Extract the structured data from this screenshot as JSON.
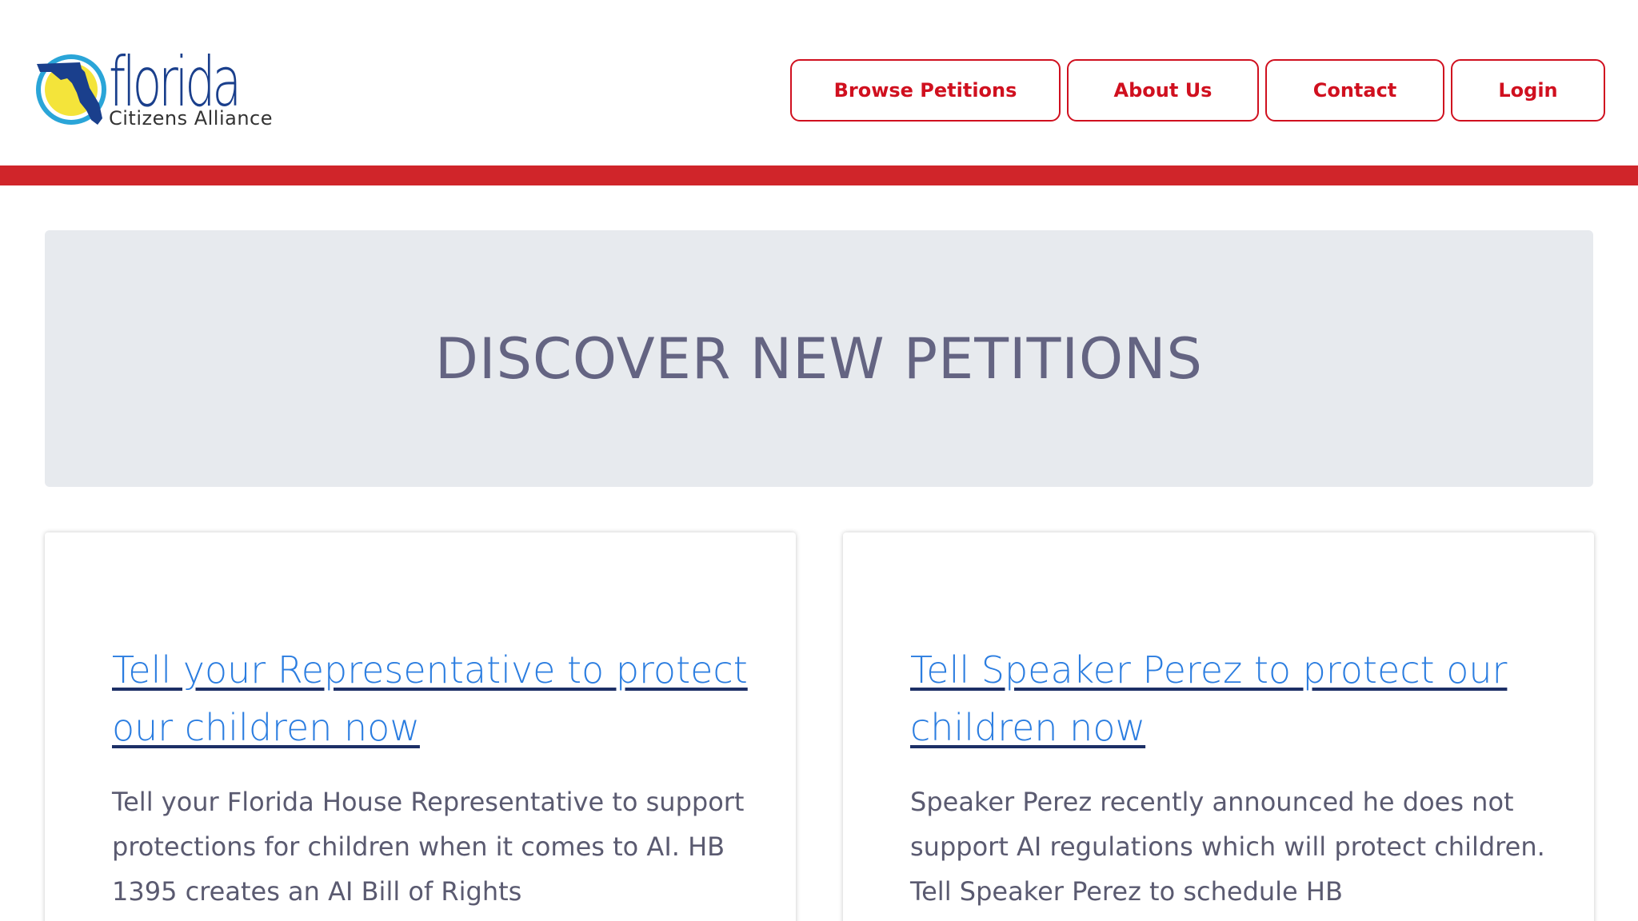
{
  "header": {
    "logo": {
      "word": "florida",
      "subtitle": "Citizens Alliance",
      "colors": {
        "sun": "#f4e43a",
        "ring": "#2aa5d8",
        "state": "#1a3f8c"
      }
    },
    "nav": [
      {
        "label": "Browse Petitions"
      },
      {
        "label": "About Us"
      },
      {
        "label": "Contact"
      },
      {
        "label": "Login"
      }
    ],
    "accent_color": "#d0101f"
  },
  "hero": {
    "title": "DISCOVER NEW PETITIONS"
  },
  "petitions": [
    {
      "title": "Tell your Representative to protect our children now",
      "description": "Tell your Florida House Representative to support protections for children when it comes to AI.   HB 1395 creates an AI Bill of Rights"
    },
    {
      "title": "Tell Speaker Perez to protect our children now",
      "description": "Speaker Perez recently announced he does not support AI regulations which will protect children. Tell Speaker Perez to schedule HB"
    }
  ]
}
